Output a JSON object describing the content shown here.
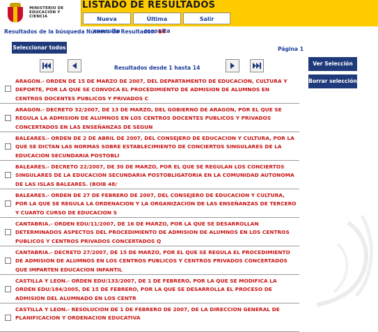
{
  "header": {
    "logo_text": "MINISTERIO DE EDUCACIÓN Y CIENCIA",
    "title": "LISTADO DE RESULTADOS",
    "buttons": {
      "new_search": "Nueva consulta",
      "last_search": "Última consulta",
      "exit": "Salir"
    }
  },
  "info": {
    "search_results_label": "Resultados de la búsqueda",
    "count_label": "Número de Resultados:",
    "count": "14",
    "select_all": "Seleccionar todos",
    "page": "Página 1"
  },
  "nav": {
    "range": "Resultados desde 1 hasta 14"
  },
  "side": {
    "view_selection": "Ver Selección",
    "clear_selection": "Borrar selección"
  },
  "results": [
    "ARAGON.- ORDEN DE 15 DE MARZO DE 2007, DEL DEPARTAMENTO DE EDUCACION, CULTURA Y DEPORTE, POR LA QUE SE CONVOCA EL PROCEDIMIENTO DE ADMISION DE ALUMNOS EN CENTROS DOCENTES PUBLICOS Y PRIVADOS C",
    "ARAGON.- DECRETO 32/2007, DE 13 DE MARZO, DEL GOBIERNO DE ARAGON, POR EL QUE SE REGULA LA ADMISION DE ALUMNOS EN LOS CENTROS DOCENTES PUBLICOS Y PRIVADOS CONCERTADOS EN LAS ENSEÑANZAS DE SEGUN",
    "BALEARES.- ORDEN DE 2 DE ABRIL DE 2007, DEL CONSEJERO DE EDUCACION Y CULTURA, POR LA QUE SE DICTAN LAS NORMAS SOBRE ESTABLECIMIENTO DE CONCIERTOS SINGULARES DE LA EDUCACION SECUNDARIA POSTOBLI",
    "BALEARES.- DECRETO 22/2007, DE 30 DE MARZO, POR EL QUE SE REGULAN LOS CONCIERTOS SINGULARES DE LA EDUCACION SECUNDARIA POSTOBLIGATORIA EN LA COMUNIDAD AUTONOMA DE LAS ISLAS BALEARES. (BOIB 48/",
    "BALEARES.- ORDEN DE 27 DE FEBRERO DE 2007, DEL CONSEJERO DE EDUCACION Y CULTURA, POR LA QUE SE REGULA LA ORDENACION Y LA ORGANIZACION DE LAS ENSEÑANZAS DE TERCERO Y CUARTO CURSO DE EDUCACION S",
    "CANTABRIA.- ORDEN EDU/11/2007, DE 16 DE MARZO, POR LA QUE SE DESARROLLAN DETERMINADOS ASPECTOS DEL PROCEDIMIENTO DE ADMISION DE ALUMNOS EN LOS CENTROS PUBLICOS Y CENTROS PRIVADOS CONCERTADOS Q",
    "CANTABRIA.- DECRETO 27/2007, DE 15 DE MARZO, POR EL QUE SE REGULA EL PROCEDIMIENTO DE ADMISION DE ALUMNOS EN LOS CENTROS PUBLICOS Y CENTROS PRIVADOS CONCERTADOS QUE IMPARTEN EDUCACION INFANTIL",
    "CASTILLA Y LEON.- ORDEN EDU/133/2007, DE 1 DE FEBRERO, POR LA QUE SE MODIFICA LA ORDEN EDU/184/2005, DE 15 DE FEBRERO, POR LA QUE SE DESARROLLA EL PROCESO DE ADMISION DEL ALUMNADO EN LOS CENTR",
    "CASTILLA Y LEON.- RESOLUCION DE 1 DE FEBRERO DE 2007, DE LA DIRECCION GENERAL DE PLANIFICACION Y ORDENACION EDUCATIVA"
  ],
  "colors": {
    "header": "#ffcc00",
    "result_text": "#c81414",
    "label_blue": "#1a3c9c",
    "button_blue": "#1f3a7a"
  }
}
